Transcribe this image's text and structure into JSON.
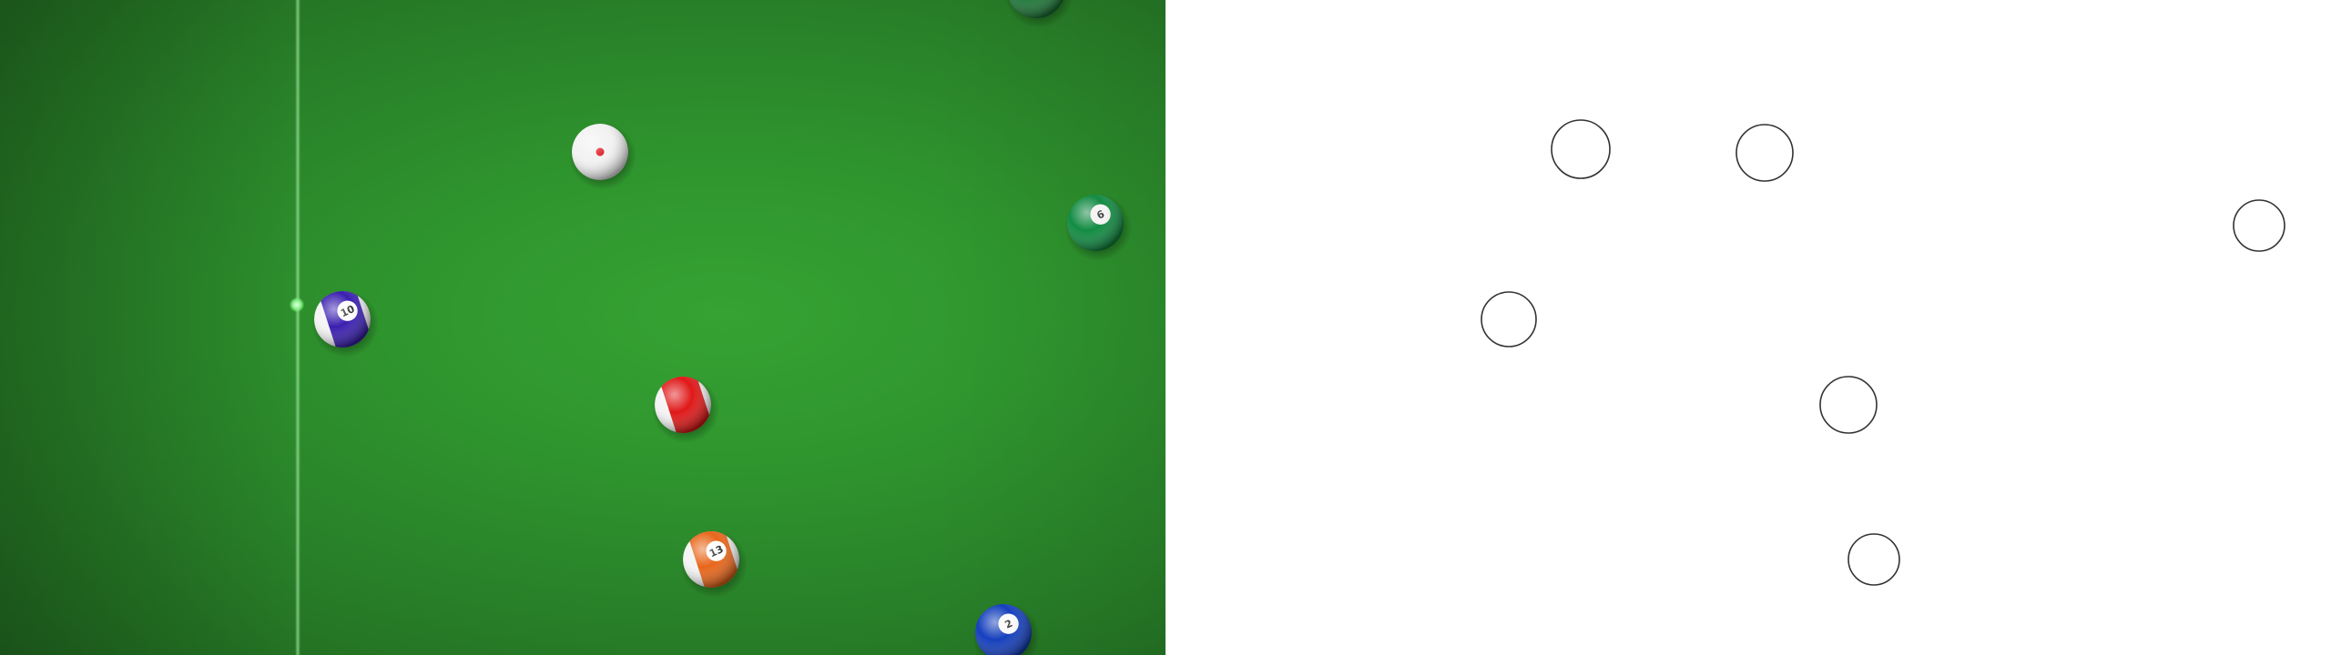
{
  "table": {
    "felt_color": "#2f962e",
    "aim_line_color": "#a8f0a8"
  },
  "balls": [
    {
      "id": "top-edge",
      "kind": "solid",
      "number": "",
      "color": "#1f7a3a"
    },
    {
      "id": "cue",
      "kind": "cue",
      "number": "",
      "color": "#f2f2f2",
      "dot": "#e0202a"
    },
    {
      "id": "green-6",
      "kind": "solid",
      "number": "6",
      "color": "#129145"
    },
    {
      "id": "blue-10",
      "kind": "stripe",
      "number": "10",
      "color": "#3a1fb0"
    },
    {
      "id": "red-11",
      "kind": "stripe",
      "number": "",
      "color": "#e01818"
    },
    {
      "id": "orange-13",
      "kind": "stripe",
      "number": "13",
      "color": "#e8661a"
    },
    {
      "id": "blue-2",
      "kind": "solid",
      "number": "2",
      "color": "#1540c0"
    }
  ],
  "outline_panel": {
    "stroke_color": "#333333",
    "circle_count": 6
  }
}
